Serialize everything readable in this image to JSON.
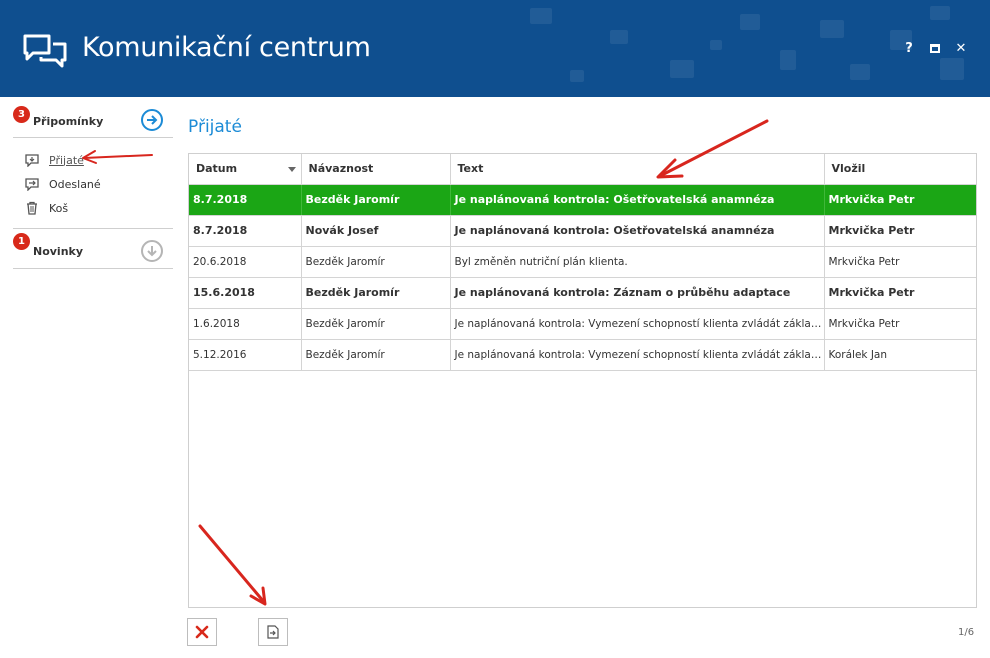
{
  "header": {
    "title": "Komunikační centrum",
    "help_label": "?",
    "close_label": "✕",
    "accent_color": "#0f4f8f"
  },
  "sidebar": {
    "sections": [
      {
        "label": "Připomínky",
        "badge": "3",
        "icon": "arrow-right-circle-icon"
      },
      {
        "label": "Novinky",
        "badge": "1",
        "icon": "arrow-down-circle-icon"
      }
    ],
    "items": [
      {
        "label": "Přijaté",
        "icon": "inbox-icon",
        "active": true
      },
      {
        "label": "Odeslané",
        "icon": "outbox-icon"
      },
      {
        "label": "Koš",
        "icon": "trash-icon"
      }
    ]
  },
  "main": {
    "title": "Přijaté",
    "columns": [
      "Datum",
      "Návaznost",
      "Text",
      "Vložil"
    ],
    "rows": [
      [
        "8.7.2018",
        "Bezděk Jaromír",
        "Je naplánovaná kontrola: Ošetřovatelská anamnéza",
        "Mrkvička Petr"
      ],
      [
        "8.7.2018",
        "Novák Josef",
        "Je naplánovaná kontrola: Ošetřovatelská anamnéza",
        "Mrkvička Petr"
      ],
      [
        "20.6.2018",
        "Bezděk Jaromír",
        "Byl změněn nutriční plán klienta.",
        "Mrkvička Petr"
      ],
      [
        "15.6.2018",
        "Bezděk Jaromír",
        "Je naplánovaná kontrola: Záznam o průběhu adaptace",
        "Mrkvička Petr"
      ],
      [
        "1.6.2018",
        "Bezděk Jaromír",
        "Je naplánovaná kontrola: Vymezení schopností klienta zvládát základní…",
        "Mrkvička Petr"
      ],
      [
        "5.12.2016",
        "Bezděk Jaromír",
        "Je naplánovaná kontrola: Vymezení schopností klienta zvládát základní…",
        "Korálek Jan"
      ]
    ],
    "selected_color": "#1ba615",
    "pager": "1/6"
  }
}
